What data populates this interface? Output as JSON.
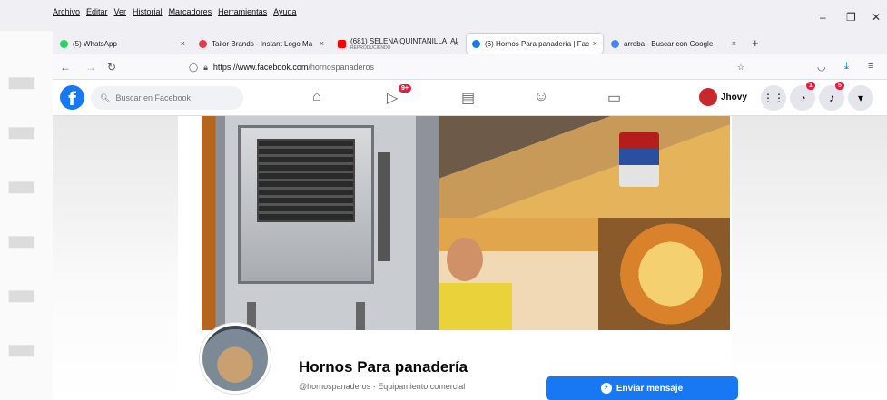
{
  "browser": {
    "menu": [
      "Archivo",
      "Editar",
      "Ver",
      "Historial",
      "Marcadores",
      "Herramientas",
      "Ayuda"
    ],
    "window_controls": {
      "minimize": "–",
      "restore": "❐",
      "close": "✕"
    },
    "tabs": [
      {
        "label": "(5) WhatsApp",
        "favicon_color": "#25d366",
        "close": "×"
      },
      {
        "label": "Tailor Brands - Instant Logo Ma",
        "favicon_color": "#e63950",
        "close": "×"
      },
      {
        "label": "(681) SELENA QUINTANILLA, Al",
        "sublabel": "REPRODUCIENDO",
        "favicon_color": "#ff0000",
        "close": "×"
      },
      {
        "label": "(6) Hornos Para panadería | Fac",
        "favicon_color": "#1877f2",
        "close": "×",
        "active": true
      },
      {
        "label": "arroba - Buscar con Google",
        "favicon_color": "#4285f4",
        "close": "×"
      }
    ],
    "new_tab": "+",
    "url": {
      "host": "https://www.facebook.com",
      "path": "/hornospanaderos"
    }
  },
  "facebook": {
    "logo": "f",
    "search_placeholder": "Buscar en Facebook",
    "badges": {
      "watch": "9+",
      "messenger": "1",
      "notifications": "5"
    },
    "user_name": "Jhovy",
    "page": {
      "name": "Hornos Para panadería",
      "subtitle": "@hornospanaderos · Equipamiento comercial",
      "message_button": "Enviar mensaje"
    }
  }
}
